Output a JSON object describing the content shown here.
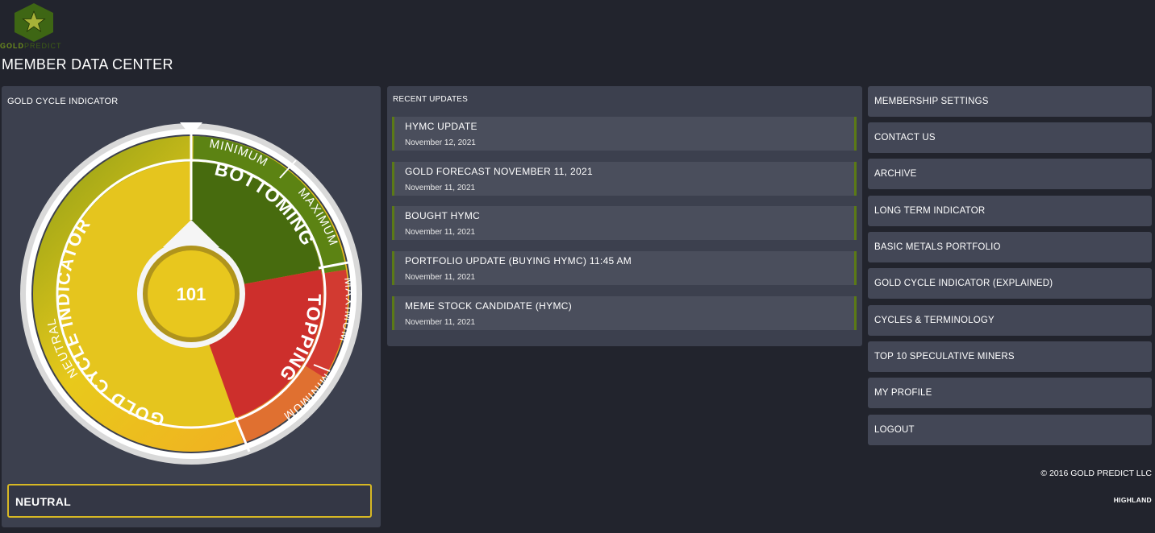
{
  "brand": {
    "logo_gold": "GOLD",
    "logo_predict": "PREDICT",
    "logo_icon": "star-hexagon-icon",
    "colors": {
      "green": "#3e6614",
      "star": "#a8b238"
    }
  },
  "page_title": "MEMBER DATA CENTER",
  "gauge": {
    "panel_title": "GOLD CYCLE INDICATOR",
    "value": "101",
    "ring_label": "GOLD CYCLE INDICATOR",
    "segments": {
      "bottoming": "BOTTOMING",
      "topping": "TOPPING",
      "neutral": "NEUTRAL",
      "minimum": "MINIMUM",
      "maximum": "MAXIMUM"
    },
    "status": "NEUTRAL",
    "colors": {
      "bottoming": "#476b0e",
      "topping": "#cd2f2c",
      "neutral": "#e5c51e",
      "outer_ring": "#f5f5f5",
      "status_border": "#d7b824"
    }
  },
  "updates": {
    "panel_title": "RECENT UPDATES",
    "items": [
      {
        "title": "HYMC UPDATE",
        "date": "November 12, 2021"
      },
      {
        "title": "GOLD FORECAST NOVEMBER 11, 2021",
        "date": "November 11, 2021"
      },
      {
        "title": "BOUGHT HYMC",
        "date": "November 11, 2021"
      },
      {
        "title": "PORTFOLIO UPDATE (BUYING HYMC) 11:45 AM",
        "date": "November 11, 2021"
      },
      {
        "title": "MEME STOCK CANDIDATE (HYMC)",
        "date": "November 11, 2021"
      }
    ]
  },
  "menu": [
    "MEMBERSHIP SETTINGS",
    "CONTACT US",
    "ARCHIVE",
    "LONG TERM INDICATOR",
    "BASIC METALS PORTFOLIO",
    "GOLD CYCLE INDICATOR (EXPLAINED)",
    "CYCLES & TERMINOLOGY",
    "TOP 10 SPECULATIVE MINERS",
    "MY PROFILE",
    "LOGOUT"
  ],
  "footer": {
    "copyright": "© 2016 GOLD PREDICT LLC",
    "credit": "HIGHLAND"
  }
}
